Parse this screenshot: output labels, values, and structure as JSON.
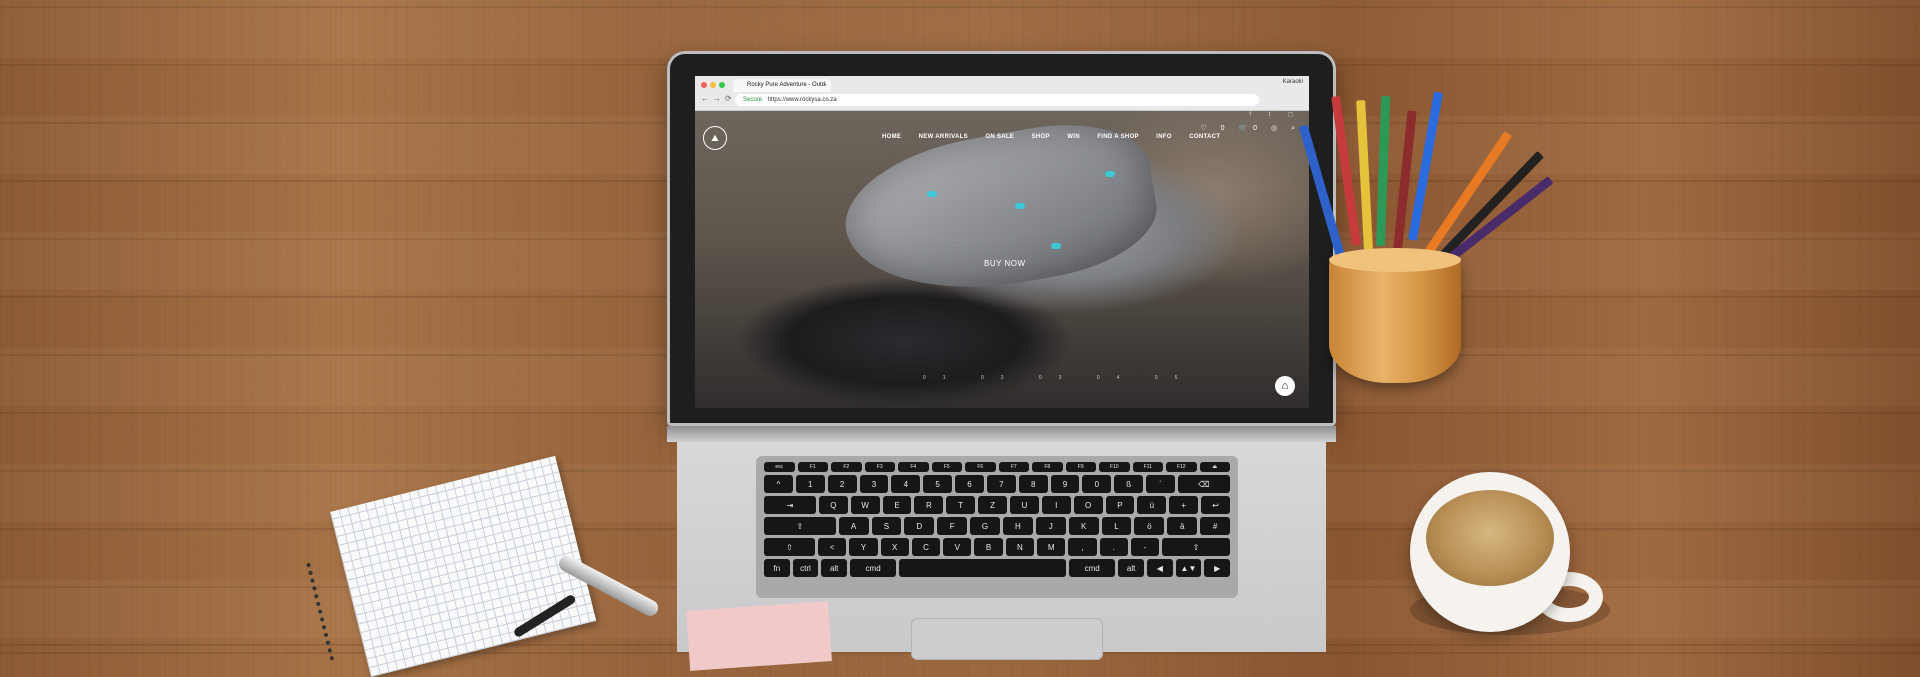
{
  "browser": {
    "tab_title": "Rocky Pure Adventure - Outd",
    "tab_close": "×",
    "profile_name": "Karaoki",
    "secure_label": "Secure",
    "url": "https://www.rockysa.co.za",
    "nav_buttons": "←→⟳"
  },
  "site": {
    "logo_glyph": "⛰",
    "nav_items": [
      "HOME",
      "NEW ARRIVALS",
      "ON SALE",
      "SHOP",
      "WIN",
      "FIND A SHOP",
      "INFO",
      "CONTACT"
    ],
    "header_icons": "♡ 0 🛒0 ◎ ⌕",
    "social_icons": "f t ◻",
    "hero_cta": "BUY NOW",
    "slider_dots": "01 02 03 04 05",
    "home_icon": "⌂",
    "accent_color": "#3cc8d4"
  },
  "keyboard": {
    "fn_row": [
      "esc",
      "F1",
      "F2",
      "F3",
      "F4",
      "F5",
      "F6",
      "F7",
      "F8",
      "F9",
      "F10",
      "F11",
      "F12",
      "⏏"
    ],
    "row1": [
      "^",
      "1",
      "2",
      "3",
      "4",
      "5",
      "6",
      "7",
      "8",
      "9",
      "0",
      "ß",
      "´",
      "⌫"
    ],
    "row2": [
      "⇥",
      "Q",
      "W",
      "E",
      "R",
      "T",
      "Z",
      "U",
      "I",
      "O",
      "P",
      "ü",
      "+",
      "↩"
    ],
    "row3": [
      "⇪",
      "A",
      "S",
      "D",
      "F",
      "G",
      "H",
      "J",
      "K",
      "L",
      "ö",
      "ä",
      "#"
    ],
    "row4": [
      "⇧",
      "<",
      "Y",
      "X",
      "C",
      "V",
      "B",
      "N",
      "M",
      ",",
      ".",
      "-",
      "⇧"
    ],
    "row5": [
      "fn",
      "ctrl",
      "alt",
      "cmd",
      "",
      "cmd",
      "alt",
      "◀",
      "▲▼",
      "▶"
    ]
  }
}
